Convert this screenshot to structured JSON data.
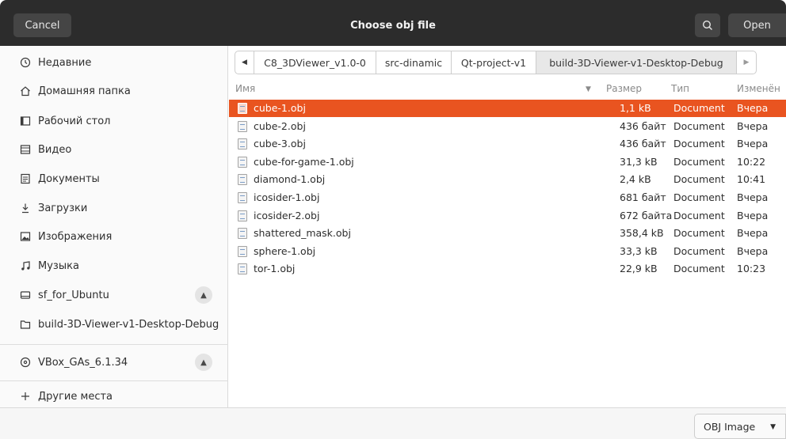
{
  "header": {
    "title": "Choose obj file",
    "cancel_label": "Cancel",
    "open_label": "Open",
    "search_icon": "search-icon"
  },
  "sidebar": {
    "items": [
      {
        "label": "Недавние",
        "icon": "clock-icon"
      },
      {
        "label": "Домашняя папка",
        "icon": "home-icon"
      },
      {
        "label": "Рабочий стол",
        "icon": "desktop-icon"
      },
      {
        "label": "Видео",
        "icon": "video-icon"
      },
      {
        "label": "Документы",
        "icon": "document-icon"
      },
      {
        "label": "Загрузки",
        "icon": "download-icon"
      },
      {
        "label": "Изображения",
        "icon": "image-icon"
      },
      {
        "label": "Музыка",
        "icon": "music-icon"
      },
      {
        "label": "sf_for_Ubuntu",
        "icon": "drive-icon",
        "ejectable": true
      },
      {
        "label": "build-3D-Viewer-v1-Desktop-Debug",
        "icon": "folder-icon"
      }
    ],
    "devices": [
      {
        "label": "VBox_GAs_6.1.34",
        "icon": "disc-icon",
        "ejectable": true
      }
    ],
    "other": {
      "label": "Другие места",
      "icon": "plus-icon"
    }
  },
  "pathbar": {
    "segments": [
      "C8_3DViewer_v1.0-0",
      "src-dinamic",
      "Qt-project-v1",
      "build-3D-Viewer-v1-Desktop-Debug"
    ],
    "active_index": 3
  },
  "columns": {
    "name": "Имя",
    "size": "Размер",
    "type": "Тип",
    "modified": "Изменён"
  },
  "files": [
    {
      "name": "cube-1.obj",
      "size": "1,1 kB",
      "type": "Document",
      "modified": "Вчера",
      "selected": true
    },
    {
      "name": "cube-2.obj",
      "size": "436 байт",
      "type": "Document",
      "modified": "Вчера"
    },
    {
      "name": "cube-3.obj",
      "size": "436 байт",
      "type": "Document",
      "modified": "Вчера"
    },
    {
      "name": "cube-for-game-1.obj",
      "size": "31,3 kB",
      "type": "Document",
      "modified": "10:22"
    },
    {
      "name": "diamond-1.obj",
      "size": "2,4 kB",
      "type": "Document",
      "modified": "10:41"
    },
    {
      "name": "icosider-1.obj",
      "size": "681 байт",
      "type": "Document",
      "modified": "Вчера"
    },
    {
      "name": "icosider-2.obj",
      "size": "672 байта",
      "type": "Document",
      "modified": "Вчера"
    },
    {
      "name": "shattered_mask.obj",
      "size": "358,4 kB",
      "type": "Document",
      "modified": "Вчера"
    },
    {
      "name": "sphere-1.obj",
      "size": "33,3 kB",
      "type": "Document",
      "modified": "Вчера"
    },
    {
      "name": "tor-1.obj",
      "size": "22,9 kB",
      "type": "Document",
      "modified": "10:23"
    }
  ],
  "filter": {
    "value": "OBJ Image"
  },
  "colors": {
    "accent": "#e95420",
    "header_bg": "#2c2c2c"
  }
}
